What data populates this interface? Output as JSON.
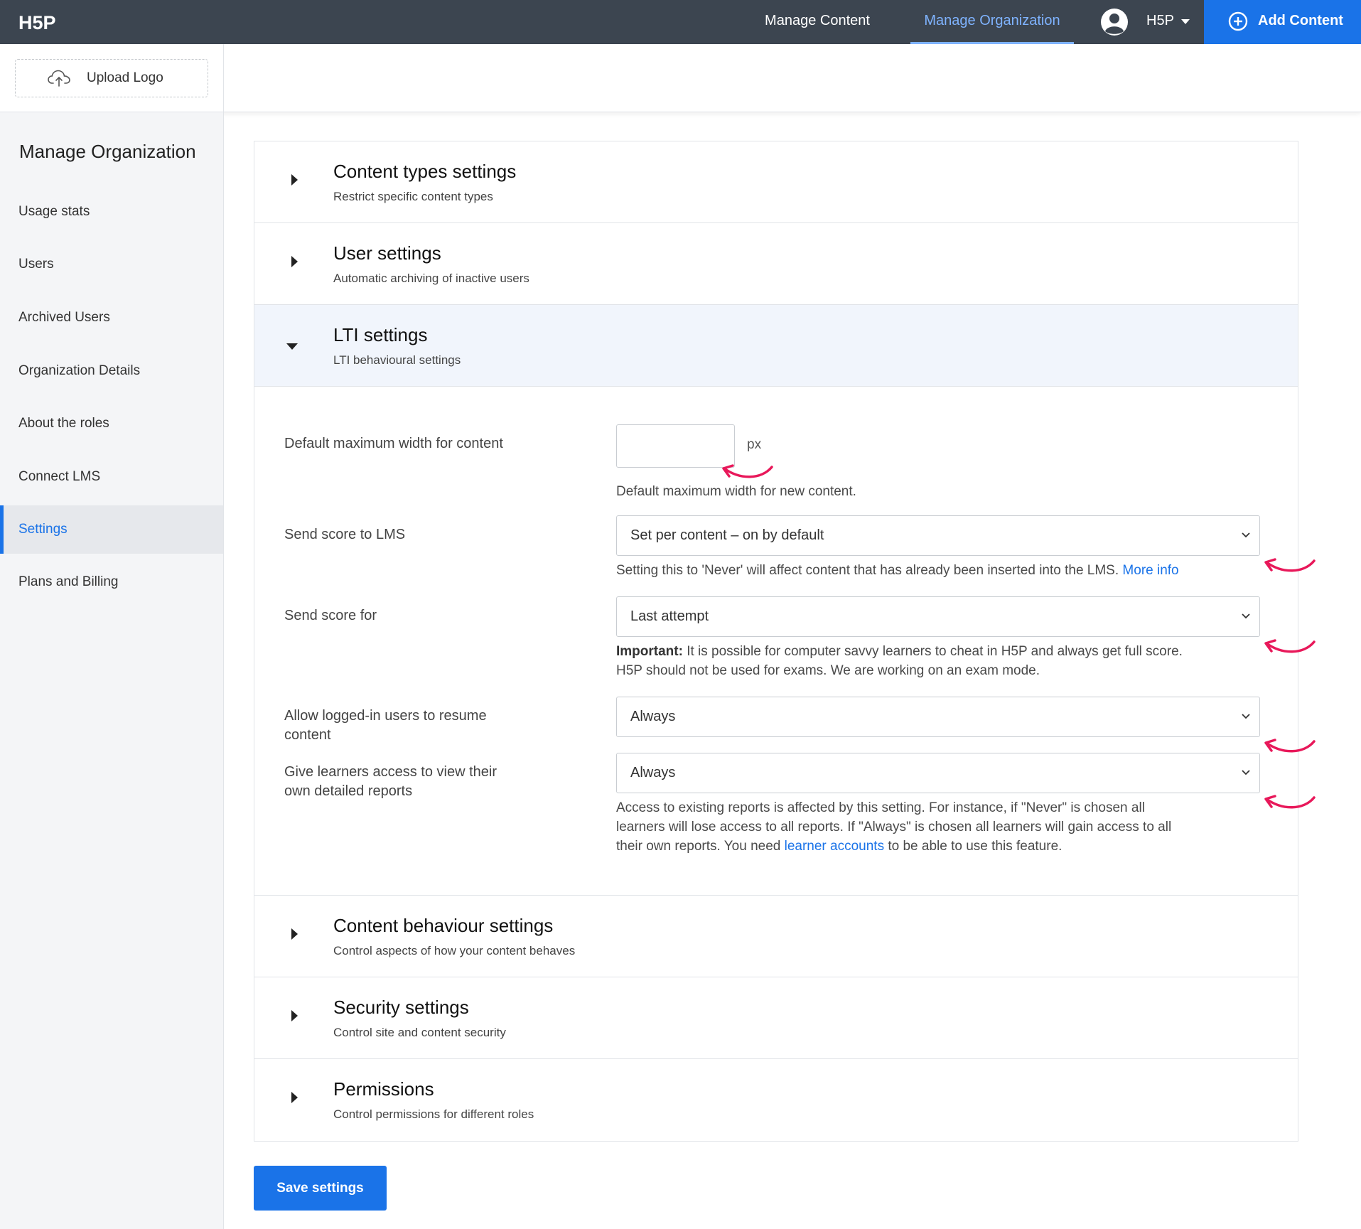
{
  "topbar": {
    "logo_text": "H5P",
    "nav": {
      "manage_content": "Manage Content",
      "manage_organization": "Manage Organization"
    },
    "user": {
      "name": "H5P"
    },
    "add_content": "Add Content"
  },
  "header": {
    "upload_logo": "Upload Logo"
  },
  "sidebar": {
    "title": "Manage Organization",
    "items": [
      {
        "label": "Usage stats"
      },
      {
        "label": "Users"
      },
      {
        "label": "Archived Users"
      },
      {
        "label": "Organization Details"
      },
      {
        "label": "About the roles"
      },
      {
        "label": "Connect LMS"
      },
      {
        "label": "Settings",
        "active": true
      },
      {
        "label": "Plans and Billing"
      }
    ]
  },
  "sections": [
    {
      "title": "Content types settings",
      "subtitle": "Restrict specific content types"
    },
    {
      "title": "User settings",
      "subtitle": "Automatic archiving of inactive users"
    },
    {
      "title": "LTI settings",
      "subtitle": "LTI behavioural settings",
      "open": true
    },
    {
      "title": "Content behaviour settings",
      "subtitle": "Control aspects of how your content behaves"
    },
    {
      "title": "Security settings",
      "subtitle": "Control site and content security"
    },
    {
      "title": "Permissions",
      "subtitle": "Control permissions for different roles"
    }
  ],
  "lti": {
    "max_width": {
      "label": "Default maximum width for content",
      "value": "",
      "unit": "px",
      "help": "Default maximum width for new content."
    },
    "send_score": {
      "label": "Send score to LMS",
      "value": "Set per content – on by default",
      "help": "Setting this to 'Never' will affect content that has already been inserted into the LMS.",
      "help_link": "More info"
    },
    "send_score_for": {
      "label": "Send score for",
      "value": "Last attempt",
      "help_bold": "Important:",
      "help_line1": " It is possible for computer savvy learners to cheat in H5P and always get full score.",
      "help_line2": "H5P should not be used for exams. We are working on an exam mode."
    },
    "resume": {
      "label_line1": "Allow logged-in users to resume",
      "label_line2": "content",
      "value": "Always"
    },
    "reports": {
      "label_line1": "Give learners access to view their",
      "label_line2": "own detailed reports",
      "value": "Always",
      "help_line1": "Access to existing reports is affected by this setting. For instance, if \"Never\" is chosen all",
      "help_line2": "learners will lose access to all reports. If \"Always\" is chosen all learners will gain access to all",
      "help_line3a": "their own reports. You need ",
      "help_link": "learner accounts",
      "help_line3b": " to be able to use this feature."
    }
  },
  "save_button": "Save settings",
  "colors": {
    "accent": "#1a73e8",
    "topbar": "#3c4550",
    "annotation": "#e8185a"
  }
}
